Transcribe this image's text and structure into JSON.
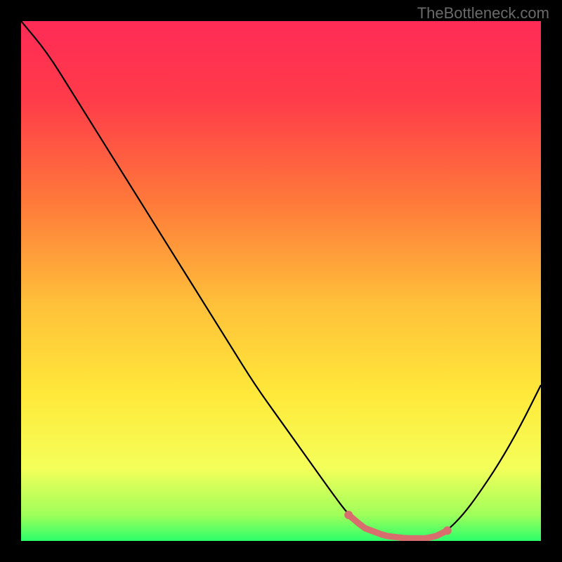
{
  "watermark": "TheBottleneck.com",
  "chart_data": {
    "type": "line",
    "title": "",
    "xlabel": "",
    "ylabel": "",
    "xlim": [
      0,
      100
    ],
    "ylim": [
      0,
      100
    ],
    "x": [
      0,
      5,
      10,
      15,
      20,
      25,
      30,
      35,
      40,
      45,
      50,
      55,
      60,
      63,
      66,
      70,
      74,
      78,
      80,
      82,
      85,
      88,
      92,
      96,
      100
    ],
    "y": [
      100,
      94,
      86,
      78,
      70,
      62,
      54,
      46,
      38,
      30,
      23,
      16,
      9,
      5,
      2.5,
      1,
      0.5,
      0.5,
      1,
      2,
      5,
      9,
      15,
      22,
      30
    ],
    "flat_region": {
      "x_start": 63,
      "x_end": 82,
      "color": "#d86d6d"
    },
    "gradient_stops": [
      {
        "offset": 0.0,
        "color": "#ff2b56"
      },
      {
        "offset": 0.15,
        "color": "#ff3b4a"
      },
      {
        "offset": 0.35,
        "color": "#ff7a3a"
      },
      {
        "offset": 0.55,
        "color": "#ffc23a"
      },
      {
        "offset": 0.72,
        "color": "#ffe93a"
      },
      {
        "offset": 0.86,
        "color": "#f4ff5a"
      },
      {
        "offset": 0.95,
        "color": "#9fff5a"
      },
      {
        "offset": 1.0,
        "color": "#2bff6a"
      }
    ]
  }
}
